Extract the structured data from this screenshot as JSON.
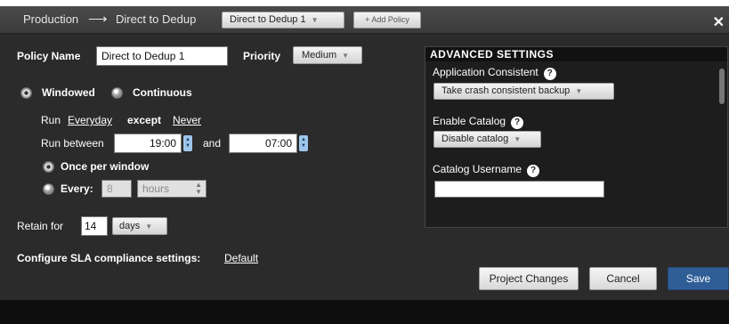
{
  "header": {
    "breadcrumb_from": "Production",
    "breadcrumb_arrow": "⟶",
    "breadcrumb_to": "Direct to Dedup",
    "policy_select": "Direct to Dedup 1",
    "add_policy": "+ Add Policy",
    "close": "✕"
  },
  "form": {
    "policy_name_label": "Policy Name",
    "policy_name_value": "Direct to Dedup 1",
    "priority_label": "Priority",
    "priority_value": "Medium",
    "mode_windowed": "Windowed",
    "mode_continuous": "Continuous",
    "run_label": "Run",
    "run_everyday": "Everyday",
    "except_label": "except",
    "except_never": "Never",
    "run_between_label": "Run between",
    "start_time": "19:00",
    "and_label": "and",
    "end_time": "07:00",
    "once_per_window": "Once per window",
    "every_label": "Every:",
    "every_value": "8",
    "every_unit": "hours",
    "retain_label": "Retain for",
    "retain_value": "14",
    "retain_unit": "days",
    "sla_label": "Configure SLA compliance settings:",
    "sla_link": "Default"
  },
  "advanced": {
    "title": "ADVANCED SETTINGS",
    "app_consistent_label": "Application Consistent",
    "app_consistent_value": "Take crash consistent backup",
    "enable_catalog_label": "Enable Catalog",
    "enable_catalog_value": "Disable catalog",
    "catalog_username_label": "Catalog Username",
    "catalog_username_value": "",
    "help_glyph": "?"
  },
  "actions": {
    "project_changes": "Project Changes",
    "cancel": "Cancel",
    "save": "Save"
  },
  "colors": {
    "save_button": "#2f5e96",
    "background": "#2b2b2b",
    "panel": "#1d1d1d"
  }
}
